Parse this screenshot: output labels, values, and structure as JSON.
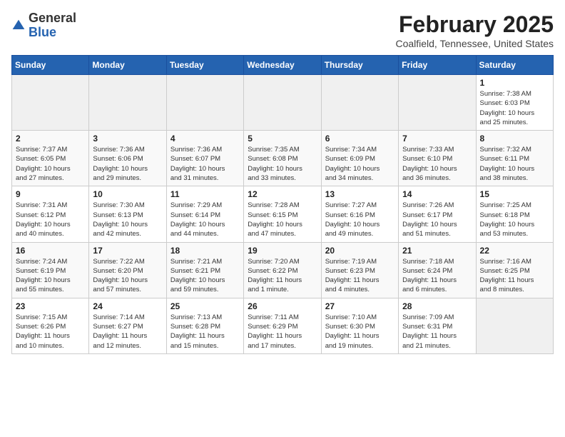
{
  "logo": {
    "general": "General",
    "blue": "Blue"
  },
  "title": "February 2025",
  "location": "Coalfield, Tennessee, United States",
  "days_of_week": [
    "Sunday",
    "Monday",
    "Tuesday",
    "Wednesday",
    "Thursday",
    "Friday",
    "Saturday"
  ],
  "weeks": [
    [
      {
        "day": "",
        "info": ""
      },
      {
        "day": "",
        "info": ""
      },
      {
        "day": "",
        "info": ""
      },
      {
        "day": "",
        "info": ""
      },
      {
        "day": "",
        "info": ""
      },
      {
        "day": "",
        "info": ""
      },
      {
        "day": "1",
        "info": "Sunrise: 7:38 AM\nSunset: 6:03 PM\nDaylight: 10 hours\nand 25 minutes."
      }
    ],
    [
      {
        "day": "2",
        "info": "Sunrise: 7:37 AM\nSunset: 6:05 PM\nDaylight: 10 hours\nand 27 minutes."
      },
      {
        "day": "3",
        "info": "Sunrise: 7:36 AM\nSunset: 6:06 PM\nDaylight: 10 hours\nand 29 minutes."
      },
      {
        "day": "4",
        "info": "Sunrise: 7:36 AM\nSunset: 6:07 PM\nDaylight: 10 hours\nand 31 minutes."
      },
      {
        "day": "5",
        "info": "Sunrise: 7:35 AM\nSunset: 6:08 PM\nDaylight: 10 hours\nand 33 minutes."
      },
      {
        "day": "6",
        "info": "Sunrise: 7:34 AM\nSunset: 6:09 PM\nDaylight: 10 hours\nand 34 minutes."
      },
      {
        "day": "7",
        "info": "Sunrise: 7:33 AM\nSunset: 6:10 PM\nDaylight: 10 hours\nand 36 minutes."
      },
      {
        "day": "8",
        "info": "Sunrise: 7:32 AM\nSunset: 6:11 PM\nDaylight: 10 hours\nand 38 minutes."
      }
    ],
    [
      {
        "day": "9",
        "info": "Sunrise: 7:31 AM\nSunset: 6:12 PM\nDaylight: 10 hours\nand 40 minutes."
      },
      {
        "day": "10",
        "info": "Sunrise: 7:30 AM\nSunset: 6:13 PM\nDaylight: 10 hours\nand 42 minutes."
      },
      {
        "day": "11",
        "info": "Sunrise: 7:29 AM\nSunset: 6:14 PM\nDaylight: 10 hours\nand 44 minutes."
      },
      {
        "day": "12",
        "info": "Sunrise: 7:28 AM\nSunset: 6:15 PM\nDaylight: 10 hours\nand 47 minutes."
      },
      {
        "day": "13",
        "info": "Sunrise: 7:27 AM\nSunset: 6:16 PM\nDaylight: 10 hours\nand 49 minutes."
      },
      {
        "day": "14",
        "info": "Sunrise: 7:26 AM\nSunset: 6:17 PM\nDaylight: 10 hours\nand 51 minutes."
      },
      {
        "day": "15",
        "info": "Sunrise: 7:25 AM\nSunset: 6:18 PM\nDaylight: 10 hours\nand 53 minutes."
      }
    ],
    [
      {
        "day": "16",
        "info": "Sunrise: 7:24 AM\nSunset: 6:19 PM\nDaylight: 10 hours\nand 55 minutes."
      },
      {
        "day": "17",
        "info": "Sunrise: 7:22 AM\nSunset: 6:20 PM\nDaylight: 10 hours\nand 57 minutes."
      },
      {
        "day": "18",
        "info": "Sunrise: 7:21 AM\nSunset: 6:21 PM\nDaylight: 10 hours\nand 59 minutes."
      },
      {
        "day": "19",
        "info": "Sunrise: 7:20 AM\nSunset: 6:22 PM\nDaylight: 11 hours\nand 1 minute."
      },
      {
        "day": "20",
        "info": "Sunrise: 7:19 AM\nSunset: 6:23 PM\nDaylight: 11 hours\nand 4 minutes."
      },
      {
        "day": "21",
        "info": "Sunrise: 7:18 AM\nSunset: 6:24 PM\nDaylight: 11 hours\nand 6 minutes."
      },
      {
        "day": "22",
        "info": "Sunrise: 7:16 AM\nSunset: 6:25 PM\nDaylight: 11 hours\nand 8 minutes."
      }
    ],
    [
      {
        "day": "23",
        "info": "Sunrise: 7:15 AM\nSunset: 6:26 PM\nDaylight: 11 hours\nand 10 minutes."
      },
      {
        "day": "24",
        "info": "Sunrise: 7:14 AM\nSunset: 6:27 PM\nDaylight: 11 hours\nand 12 minutes."
      },
      {
        "day": "25",
        "info": "Sunrise: 7:13 AM\nSunset: 6:28 PM\nDaylight: 11 hours\nand 15 minutes."
      },
      {
        "day": "26",
        "info": "Sunrise: 7:11 AM\nSunset: 6:29 PM\nDaylight: 11 hours\nand 17 minutes."
      },
      {
        "day": "27",
        "info": "Sunrise: 7:10 AM\nSunset: 6:30 PM\nDaylight: 11 hours\nand 19 minutes."
      },
      {
        "day": "28",
        "info": "Sunrise: 7:09 AM\nSunset: 6:31 PM\nDaylight: 11 hours\nand 21 minutes."
      },
      {
        "day": "",
        "info": ""
      }
    ]
  ]
}
